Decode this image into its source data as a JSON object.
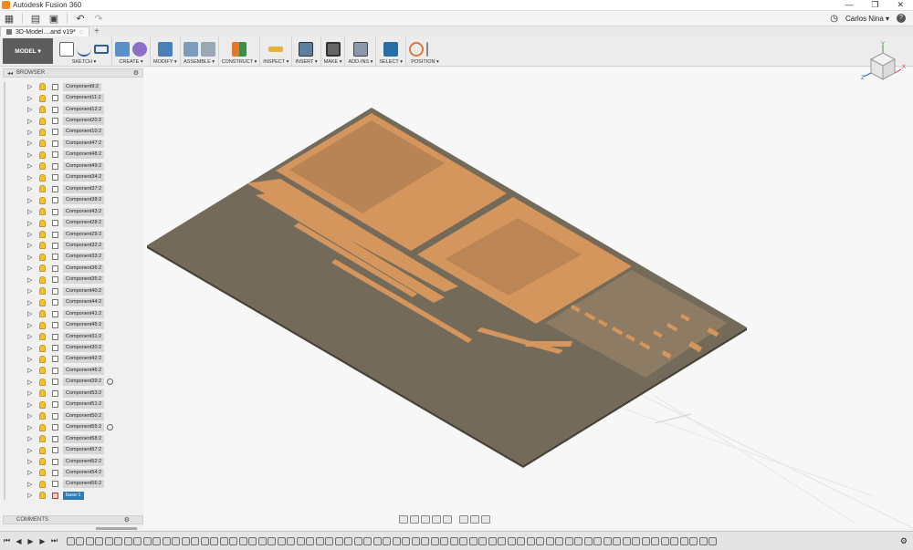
{
  "window": {
    "title": "Autodesk Fusion 360",
    "controls": [
      "—",
      "❐",
      "✕"
    ]
  },
  "quick_access": {
    "user_name": "Carlos Nina ▾",
    "help": "?"
  },
  "document_tab": {
    "label": "3D-Model....and v19*",
    "new_tab": "+"
  },
  "toolbar": {
    "workspace": "MODEL ▾",
    "groups": [
      {
        "label": "SKETCH ▾"
      },
      {
        "label": "CREATE ▾"
      },
      {
        "label": "MODIFY ▾"
      },
      {
        "label": "ASSEMBLE ▾"
      },
      {
        "label": "CONSTRUCT ▾"
      },
      {
        "label": "INSPECT ▾"
      },
      {
        "label": "INSERT ▾"
      },
      {
        "label": "MAKE ▾"
      },
      {
        "label": "ADD-INS ▾"
      },
      {
        "label": "SELECT ▾"
      },
      {
        "label": "POSITION ▾"
      }
    ]
  },
  "browser": {
    "title": "BROWSER",
    "items": [
      {
        "label": "Component9:2"
      },
      {
        "label": "Component11:2"
      },
      {
        "label": "Component12:2"
      },
      {
        "label": "Component20:2"
      },
      {
        "label": "Component10:2"
      },
      {
        "label": "Component47:2"
      },
      {
        "label": "Component48:2"
      },
      {
        "label": "Component49:2"
      },
      {
        "label": "Component34:2"
      },
      {
        "label": "Component37:2"
      },
      {
        "label": "Component38:2"
      },
      {
        "label": "Component43:2"
      },
      {
        "label": "Component28:2"
      },
      {
        "label": "Component29:2"
      },
      {
        "label": "Component32:2"
      },
      {
        "label": "Component33:2"
      },
      {
        "label": "Component36:2"
      },
      {
        "label": "Component35:2"
      },
      {
        "label": "Component40:2"
      },
      {
        "label": "Component44:2"
      },
      {
        "label": "Component41:2"
      },
      {
        "label": "Component45:2"
      },
      {
        "label": "Component31:2"
      },
      {
        "label": "Component30:2"
      },
      {
        "label": "Component42:2"
      },
      {
        "label": "Component46:2"
      },
      {
        "label": "Component39:2",
        "target": true
      },
      {
        "label": "Component53:2"
      },
      {
        "label": "Component51:2"
      },
      {
        "label": "Component50:2"
      },
      {
        "label": "Component55:2",
        "target": true
      },
      {
        "label": "Component58:2"
      },
      {
        "label": "Component57:2"
      },
      {
        "label": "Component52:2"
      },
      {
        "label": "Component54:2"
      },
      {
        "label": "Component56:2"
      },
      {
        "label": "base:1",
        "active": true
      }
    ]
  },
  "comments": {
    "title": "COMMENTS"
  },
  "viewcube": {
    "axis_x": "X",
    "axis_y": "Y",
    "axis_z": "Z"
  },
  "colors": {
    "plate": "#736a5a",
    "parts": "#d4965c",
    "selection": "#2b7bb9"
  }
}
